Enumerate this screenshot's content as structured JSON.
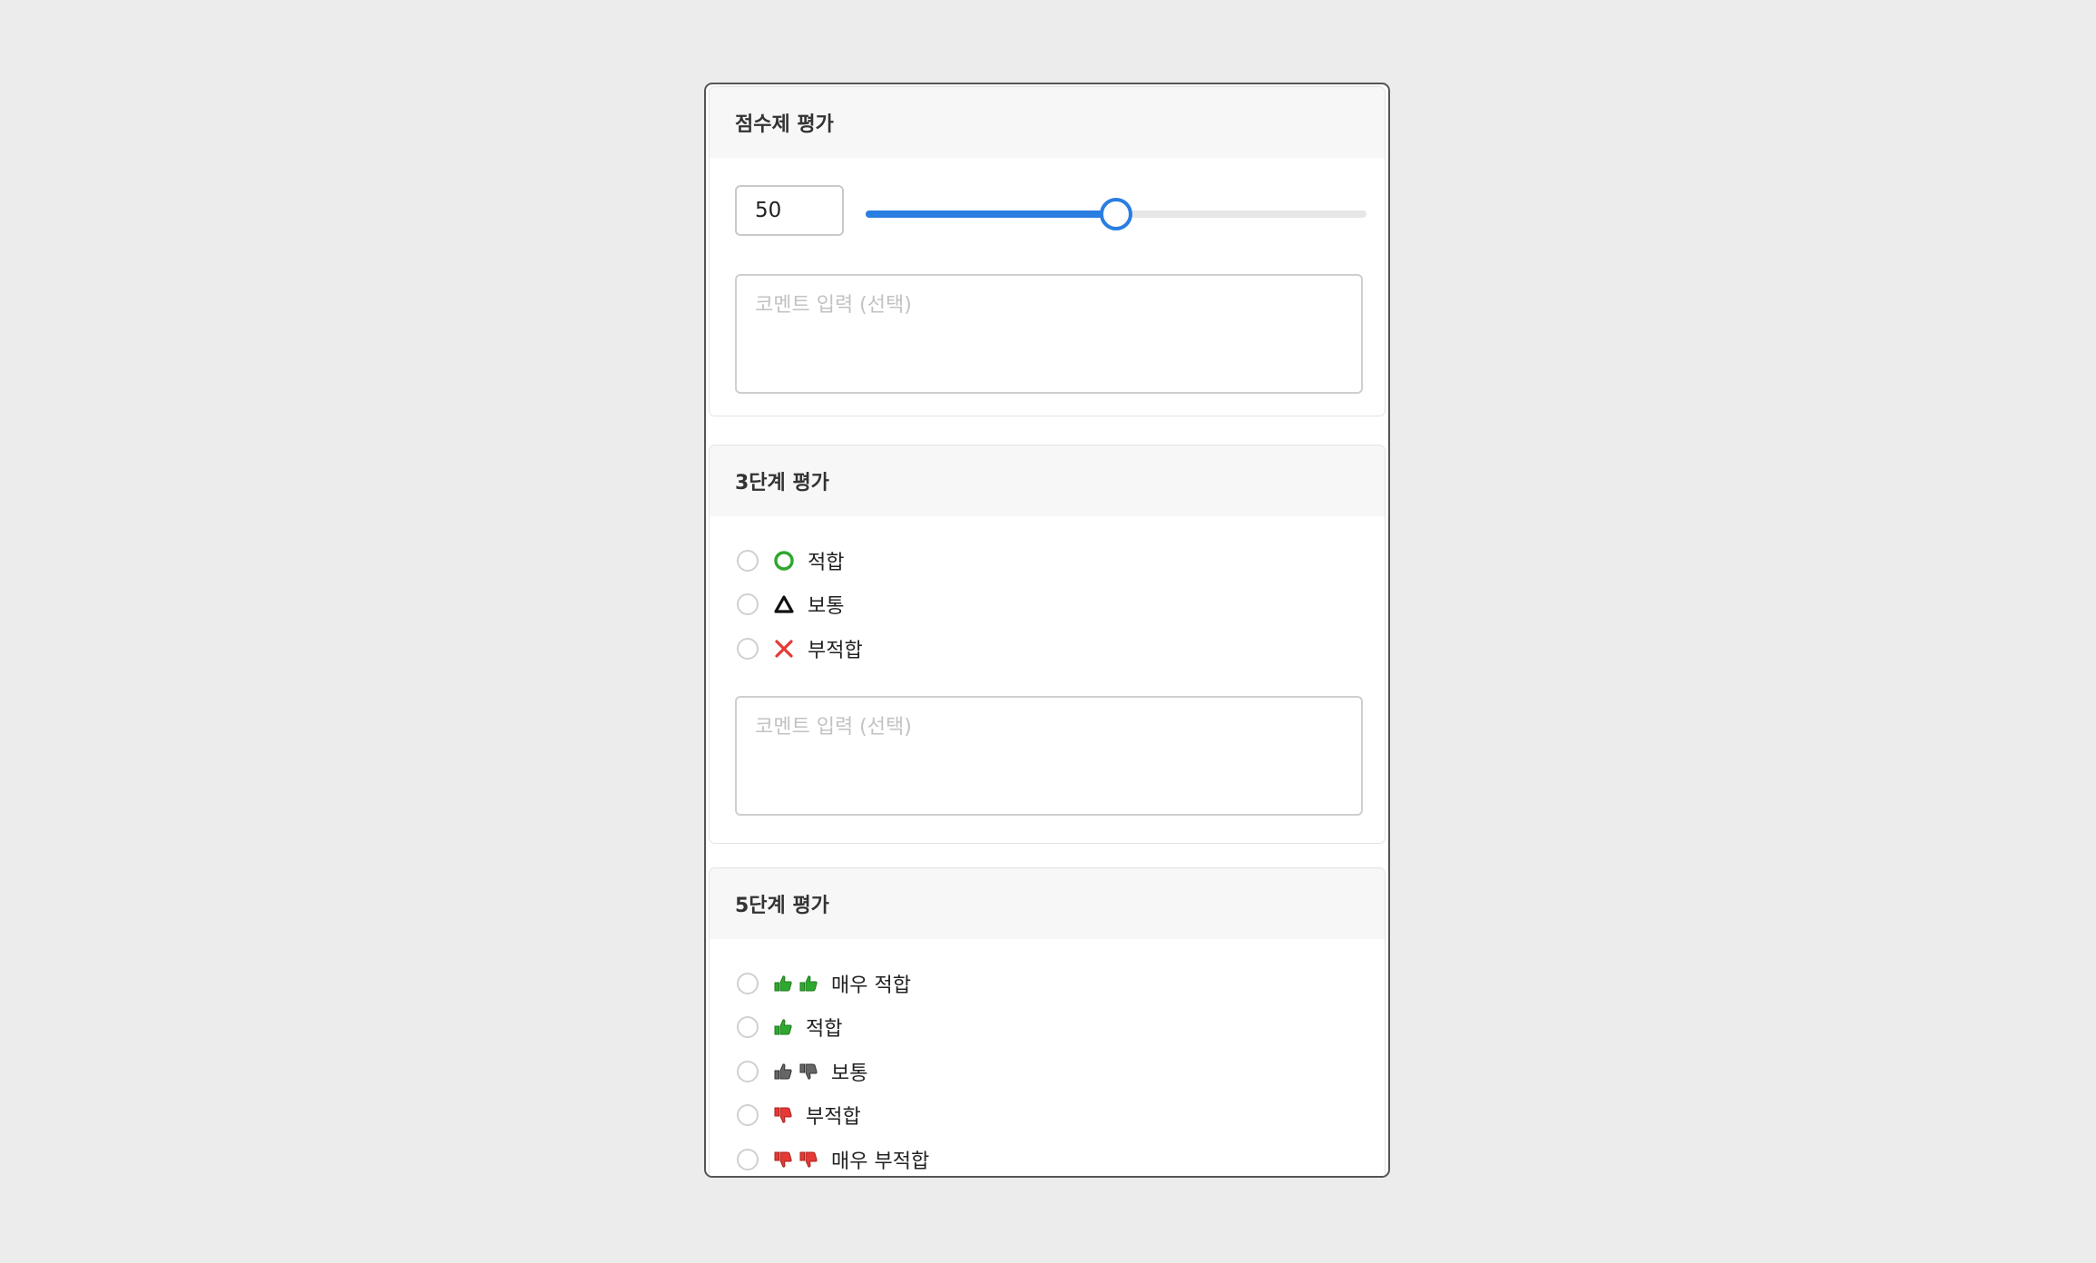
{
  "score_section": {
    "title": "점수제 평가",
    "score_value": "50",
    "slider_fraction": 0.5,
    "comment_placeholder": "코멘트 입력 (선택)"
  },
  "three_level_section": {
    "title": "3단계 평가",
    "options": [
      {
        "label": "적합",
        "icon": "circle-icon",
        "color": "#2ea82e"
      },
      {
        "label": "보통",
        "icon": "triangle-icon",
        "color": "#111111"
      },
      {
        "label": "부적합",
        "icon": "x-icon",
        "color": "#e53935"
      }
    ],
    "comment_placeholder": "코멘트 입력 (선택)"
  },
  "five_level_section": {
    "title": "5단계 평가",
    "options": [
      {
        "label": "매우 적합",
        "icons": [
          "thumbs-up-icon",
          "thumbs-up-icon"
        ]
      },
      {
        "label": "적합",
        "icons": [
          "thumbs-up-icon"
        ]
      },
      {
        "label": "보통",
        "icons": [
          "thumbs-up-icon",
          "thumbs-down-icon"
        ]
      },
      {
        "label": "부적합",
        "icons": [
          "thumbs-down-icon"
        ]
      },
      {
        "label": "매우 부적합",
        "icons": [
          "thumbs-down-icon",
          "thumbs-down-icon"
        ]
      }
    ]
  },
  "colors": {
    "accent": "#2a7de1",
    "positive": "#2ea82e",
    "negative": "#e53935",
    "neutral": "#555555"
  }
}
